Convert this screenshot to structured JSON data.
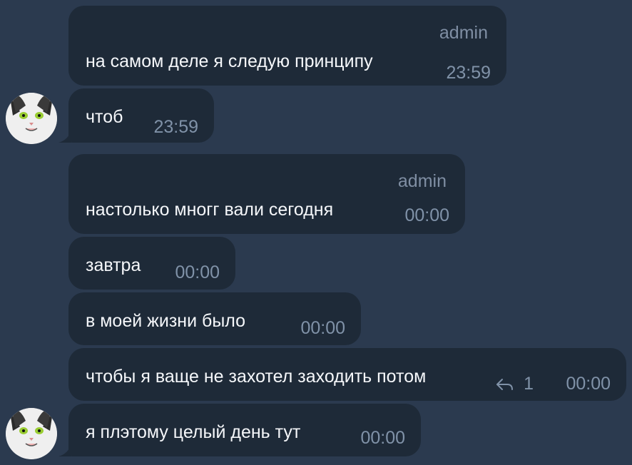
{
  "messages": [
    {
      "sender": "admin",
      "text": "на самом деле я следую принципу",
      "time": "23:59"
    },
    {
      "text": "чтоб",
      "time": "23:59"
    },
    {
      "sender": "admin",
      "text": "настолько многг вали сегодня",
      "time": "00:00"
    },
    {
      "text": "завтра",
      "time": "00:00"
    },
    {
      "text": "в моей жизни было",
      "time": "00:00"
    },
    {
      "text": "чтобы я ваще не захотел заходить потом",
      "time": "00:00",
      "reply_count": "1"
    },
    {
      "text": "я плэтому целый день тут",
      "time": "00:00"
    }
  ],
  "colors": {
    "background": "#2b3a4f",
    "bubble": "#1e2a38",
    "text": "#f5f7fa",
    "meta": "#8092a8"
  },
  "icons": {
    "avatar": "cat-avatar-icon",
    "reply": "reply-arrow-icon"
  }
}
